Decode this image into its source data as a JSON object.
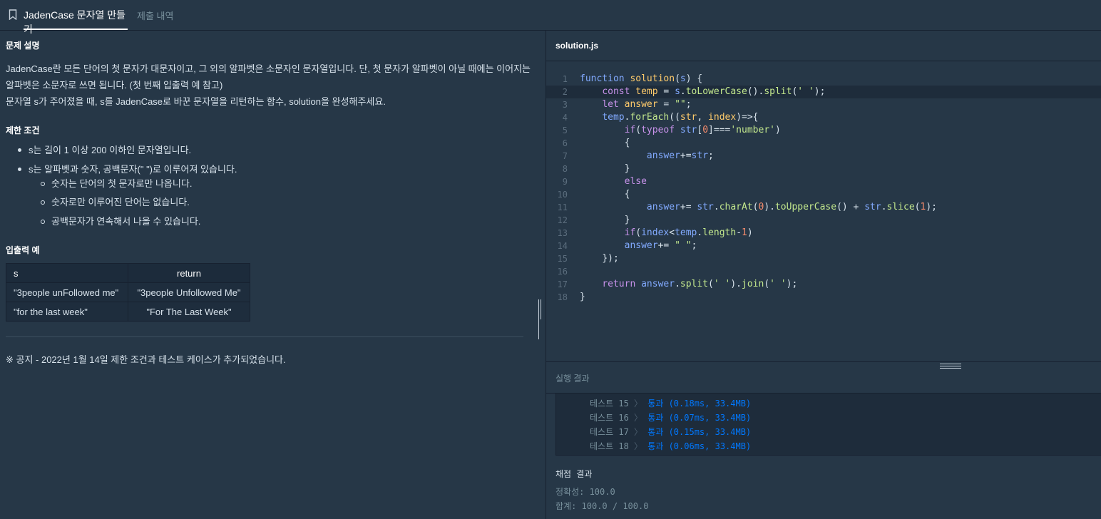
{
  "tabs": [
    {
      "label": "JadenCase 문자열 만들기",
      "active": true
    },
    {
      "label": "제출 내역",
      "active": false
    }
  ],
  "problem": {
    "desc_heading": "문제 설명",
    "desc_lines": [
      "JadenCase란 모든 단어의 첫 문자가 대문자이고, 그 외의 알파벳은 소문자인 문자열입니다. 단, 첫 문자가 알파벳이 아닐 때에는 이어지는",
      "알파벳은 소문자로 쓰면 됩니다. (첫 번째 입출력 예 참고)",
      "문자열 s가 주어졌을 때, s를 JadenCase로 바꾼 문자열을 리턴하는 함수, solution을 완성해주세요."
    ],
    "constraints_heading": "제한 조건",
    "constraints": [
      "s는 길이 1 이상 200 이하인 문자열입니다.",
      "s는 알파벳과 숫자, 공백문자(\" \")로 이루어져 있습니다."
    ],
    "sub_constraints": [
      "숫자는 단어의 첫 문자로만 나옵니다.",
      "숫자로만 이루어진 단어는 없습니다.",
      "공백문자가 연속해서 나올 수 있습니다."
    ],
    "io_heading": "입출력 예",
    "io_table": {
      "headers": [
        "s",
        "return"
      ],
      "rows": [
        [
          "\"3people unFollowed me\"",
          "\"3people Unfollowed Me\""
        ],
        [
          "\"for the last week\"",
          "\"For The Last Week\""
        ]
      ]
    },
    "notice": "※ 공지 - 2022년 1월 14일 제한 조건과 테스트 케이스가 추가되었습니다."
  },
  "editor": {
    "filename": "solution.js",
    "line_numbers": [
      "1",
      "2",
      "3",
      "4",
      "5",
      "6",
      "7",
      "8",
      "9",
      "10",
      "11",
      "12",
      "13",
      "14",
      "15",
      "16",
      "17",
      "18"
    ]
  },
  "results": {
    "heading": "실행 결과",
    "tests": [
      {
        "name": "테스트 15",
        "sep": "〉",
        "result": "통과 (0.18ms, 33.4MB)"
      },
      {
        "name": "테스트 16",
        "sep": "〉",
        "result": "통과 (0.07ms, 33.4MB)"
      },
      {
        "name": "테스트 17",
        "sep": "〉",
        "result": "통과 (0.15ms, 33.4MB)"
      },
      {
        "name": "테스트 18",
        "sep": "〉",
        "result": "통과 (0.06ms, 33.4MB)"
      }
    ],
    "score_heading": "채점 결과",
    "accuracy": "정확성: 100.0",
    "total": "합계: 100.0 / 100.0"
  }
}
